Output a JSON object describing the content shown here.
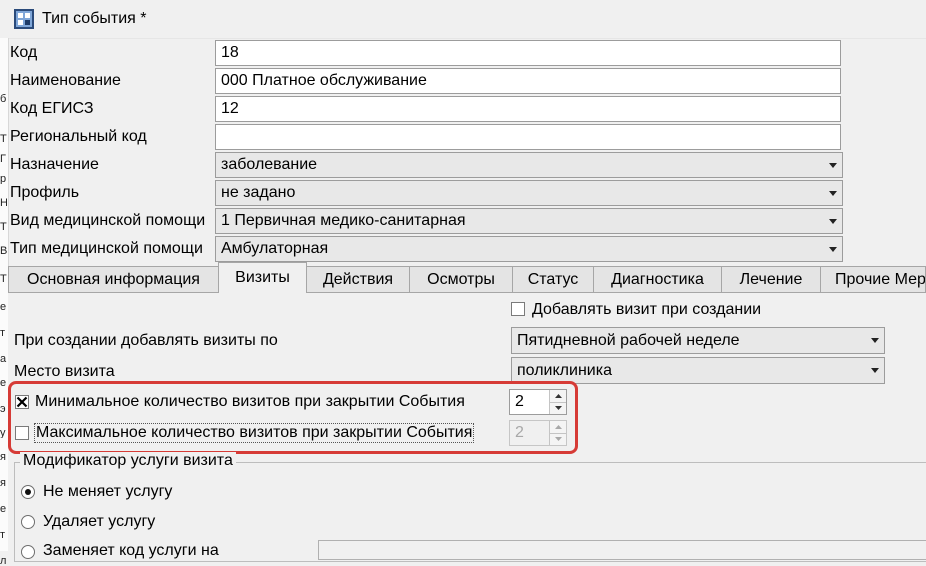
{
  "window": {
    "title": "Тип события *"
  },
  "left_strip_glyphs": [
    "б",
    "Т",
    "Г",
    "р",
    "Н",
    "Т",
    "В",
    "Т",
    "е",
    "т",
    "а",
    "е",
    "э",
    "у",
    "я",
    "я",
    "е",
    "т",
    "л"
  ],
  "form": {
    "code": {
      "label": "Код",
      "value": "18"
    },
    "name": {
      "label": "Наименование",
      "value": "000 Платное обслуживание"
    },
    "egisz": {
      "label": "Код ЕГИСЗ",
      "value": "12"
    },
    "regional": {
      "label": "Региональный код",
      "value": ""
    },
    "purpose": {
      "label": "Назначение",
      "value": "заболевание"
    },
    "profile": {
      "label": "Профиль",
      "value": "не задано"
    },
    "care_kind": {
      "label": "Вид медицинской помощи",
      "value": "1 Первичная медико-санитарная"
    },
    "care_type": {
      "label": "Тип медицинской помощи",
      "value": "Амбулаторная"
    }
  },
  "tabs": [
    {
      "label": "Основная информация",
      "active": false
    },
    {
      "label": "Визиты",
      "active": true
    },
    {
      "label": "Действия",
      "active": false
    },
    {
      "label": "Осмотры",
      "active": false
    },
    {
      "label": "Статус",
      "active": false
    },
    {
      "label": "Диагностика",
      "active": false
    },
    {
      "label": "Лечение",
      "active": false
    },
    {
      "label": "Прочие Мер",
      "active": false
    }
  ],
  "visits": {
    "add_on_create": {
      "label": "Добавлять визит при создании",
      "checked": false
    },
    "add_by": {
      "label": "При создании добавлять визиты по",
      "value": "Пятидневной рабочей неделе"
    },
    "place": {
      "label": "Место визита",
      "value": "поликлиника"
    },
    "min_visits": {
      "label": "Минимальное количество визитов при закрытии События",
      "checked": true,
      "value": "2"
    },
    "max_visits": {
      "label": "Максимальное количество визитов при закрытии События",
      "checked": false,
      "value": "2"
    },
    "modifier": {
      "title": "Модификатор услуги визита",
      "options": [
        {
          "label": "Не меняет услугу",
          "selected": true
        },
        {
          "label": "Удаляет услугу",
          "selected": false
        },
        {
          "label": "Заменяет код услуги на",
          "selected": false
        }
      ]
    }
  },
  "colors": {
    "highlight": "#d63b36",
    "background": "#f0f0f0"
  }
}
